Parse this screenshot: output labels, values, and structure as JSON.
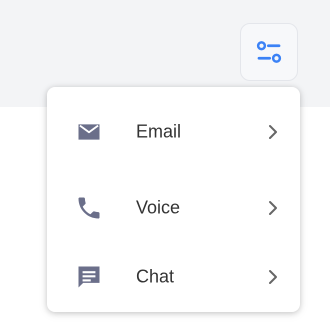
{
  "colors": {
    "accent": "#3b82f6",
    "menu_icon": "#6b6f8a",
    "text": "#333333",
    "chevron": "#666666",
    "topbar_bg": "#f3f4f6"
  },
  "toolbar": {
    "filter_icon": "sliders-icon"
  },
  "menu": {
    "items": [
      {
        "label": "Email",
        "icon": "envelope-icon"
      },
      {
        "label": "Voice",
        "icon": "phone-icon"
      },
      {
        "label": "Chat",
        "icon": "chat-icon"
      }
    ]
  }
}
